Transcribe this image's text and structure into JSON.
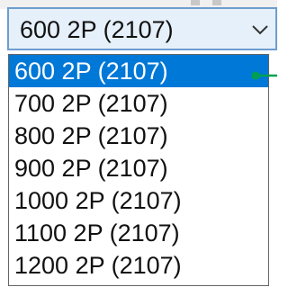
{
  "combo": {
    "value": "600 2P (2107)",
    "icon": "chevron-down-icon"
  },
  "dropdown": {
    "options": [
      {
        "label": "600 2P (2107)",
        "selected": true
      },
      {
        "label": "700 2P (2107)",
        "selected": false
      },
      {
        "label": "800 2P (2107)",
        "selected": false
      },
      {
        "label": "900 2P (2107)",
        "selected": false
      },
      {
        "label": "1000 2P (2107)",
        "selected": false
      },
      {
        "label": "1100 2P (2107)",
        "selected": false
      },
      {
        "label": "1200 2P (2107)",
        "selected": false
      }
    ]
  },
  "colors": {
    "selection_bg": "#0078d7",
    "combo_bg": "#e6f0fa",
    "combo_border": "#6e9cd0",
    "pointer": "#00a050"
  }
}
